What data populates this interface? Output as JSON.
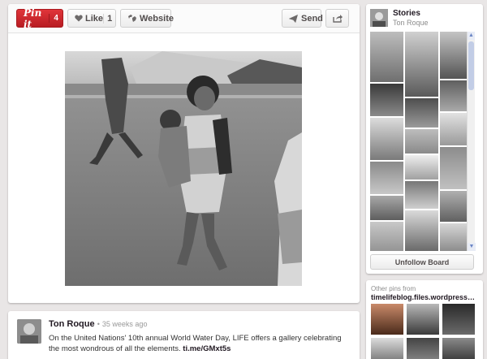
{
  "toolbar": {
    "pinit_label": "Pin it",
    "pinit_count": "4",
    "like_label": "Like",
    "like_count": "1",
    "website_label": "Website",
    "send_label": "Send"
  },
  "comment": {
    "author": "Ton Roque",
    "separator": "•",
    "time_ago": "35 weeks ago",
    "description": "On the United Nations' 10th annual World Water Day, LIFE offers a gallery celebrating the most wondrous of all the elements.",
    "link": "ti.me/GMxt5s"
  },
  "board": {
    "title": "Stories",
    "owner": "Ton Roque",
    "unfollow_label": "Unfollow Board"
  },
  "other_pins": {
    "label": "Other pins from",
    "source": "timelifeblog.files.wordpress.com"
  },
  "icons": {
    "like": "heart-icon",
    "website": "globe-icon",
    "send": "send-arrow-icon",
    "share": "share-icon",
    "scroll_up": "chevron-up-icon",
    "scroll_down": "chevron-down-icon"
  },
  "colors": {
    "pinit_red": "#cb2027",
    "background": "#e9e6e6",
    "card": "#ffffff"
  }
}
